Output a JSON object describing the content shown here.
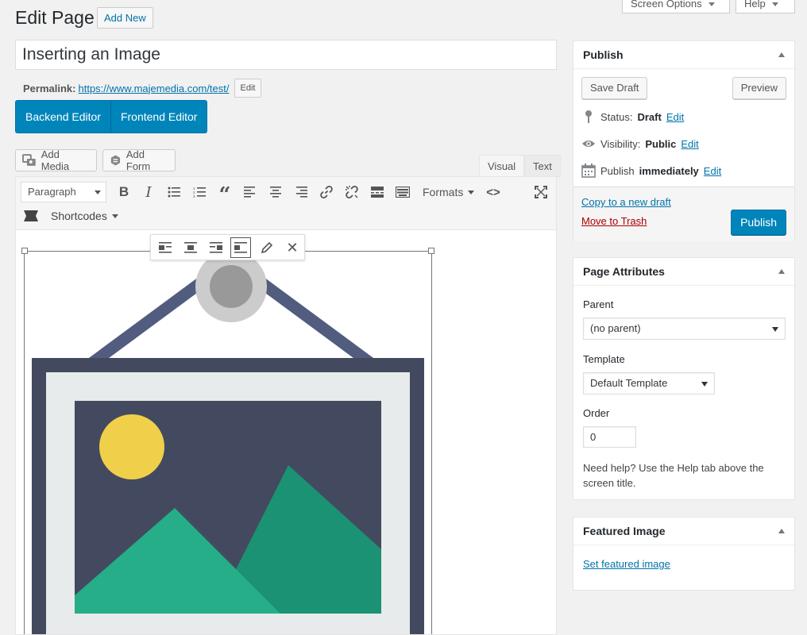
{
  "header": {
    "title": "Edit Page",
    "add_new": "Add New",
    "screen_options": "Screen Options",
    "help": "Help"
  },
  "post": {
    "title": "Inserting an Image",
    "permalink_label": "Permalink:",
    "permalink_url": "https://www.majemedia.com/test/",
    "permalink_edit": "Edit"
  },
  "editor_switch": {
    "backend": "Backend Editor",
    "frontend": "Frontend Editor"
  },
  "media": {
    "add_media": "Add Media",
    "add_form": "Add Form"
  },
  "editor_tabs": {
    "visual": "Visual",
    "text": "Text"
  },
  "toolbar": {
    "format_select": "Paragraph",
    "formats": "Formats",
    "shortcodes": "Shortcodes"
  },
  "publish": {
    "title": "Publish",
    "save_draft": "Save Draft",
    "preview": "Preview",
    "status_label": "Status:",
    "status_value": "Draft",
    "visibility_label": "Visibility:",
    "visibility_value": "Public",
    "publish_label": "Publish",
    "publish_value": "immediately",
    "edit": "Edit",
    "copy_draft": "Copy to a new draft",
    "move_trash": "Move to Trash",
    "publish_button": "Publish"
  },
  "page_attributes": {
    "title": "Page Attributes",
    "parent_label": "Parent",
    "parent_value": "(no parent)",
    "template_label": "Template",
    "template_value": "Default Template",
    "order_label": "Order",
    "order_value": "0",
    "help_text": "Need help? Use the Help tab above the screen title."
  },
  "featured_image": {
    "title": "Featured Image",
    "set_link": "Set featured image"
  },
  "colors": {
    "primary": "#0085ba",
    "link": "#0073aa",
    "trash": "#a00"
  }
}
